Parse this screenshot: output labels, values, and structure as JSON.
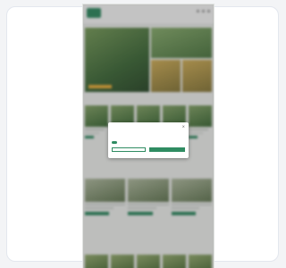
{
  "site": {
    "logo_text": "",
    "nav": [
      "",
      "",
      "",
      "",
      "",
      "",
      "",
      ""
    ]
  },
  "sections": {
    "products_title": "",
    "products_link": "",
    "content_title": "",
    "bottom_title": ""
  },
  "usps": [
    "",
    "",
    "",
    ""
  ],
  "cookie_modal": {
    "title": "",
    "text": "",
    "toggle_label": "",
    "secondary_button": "",
    "primary_button": "",
    "link": ""
  },
  "colors": {
    "brand": "#2f8c62",
    "accent": "#f0b23b"
  }
}
